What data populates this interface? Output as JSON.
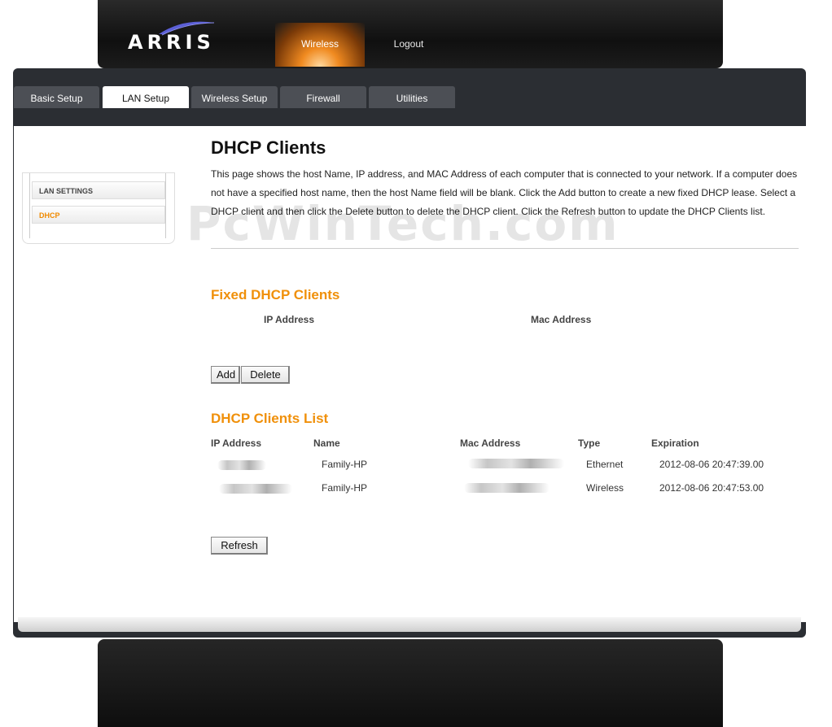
{
  "brand": {
    "logo_text": "ARRIS"
  },
  "top_nav": {
    "wireless": "Wireless",
    "logout": "Logout"
  },
  "tabs": [
    {
      "label": "Basic Setup"
    },
    {
      "label": "LAN Setup"
    },
    {
      "label": "Wireless Setup"
    },
    {
      "label": "Firewall"
    },
    {
      "label": "Utilities"
    }
  ],
  "sidebar": {
    "items": [
      {
        "label": "LAN SETTINGS"
      },
      {
        "label": "DHCP"
      }
    ]
  },
  "page": {
    "title": "DHCP Clients",
    "description": "This page shows the host Name, IP address, and MAC Address of each computer that is connected to your network. If a computer does not have a specified host name, then the host Name field will be blank. Click the Add button to create a new fixed DHCP lease. Select a DHCP client and then click the Delete button to delete the DHCP client. Click the Refresh button to update the DHCP Clients list.",
    "watermark": "PcWinTech.com"
  },
  "fixed_clients": {
    "title": "Fixed DHCP Clients",
    "columns": {
      "ip": "IP Address",
      "mac": "Mac Address"
    },
    "add_label": "Add",
    "delete_label": "Delete"
  },
  "clients_list": {
    "title": "DHCP Clients List",
    "columns": {
      "ip": "IP Address",
      "name": "Name",
      "mac": "Mac Address",
      "type": "Type",
      "expiration": "Expiration"
    },
    "rows": [
      {
        "name": "Family-HP",
        "type": "Ethernet",
        "expiration": "2012-08-06 20:47:39.00"
      },
      {
        "name": "Family-HP",
        "type": "Wireless",
        "expiration": "2012-08-06 20:47:53.00"
      }
    ],
    "refresh_label": "Refresh"
  },
  "colors": {
    "accent": "#f0900a",
    "frame": "#2b2e33",
    "tab": "#4c4f55"
  }
}
